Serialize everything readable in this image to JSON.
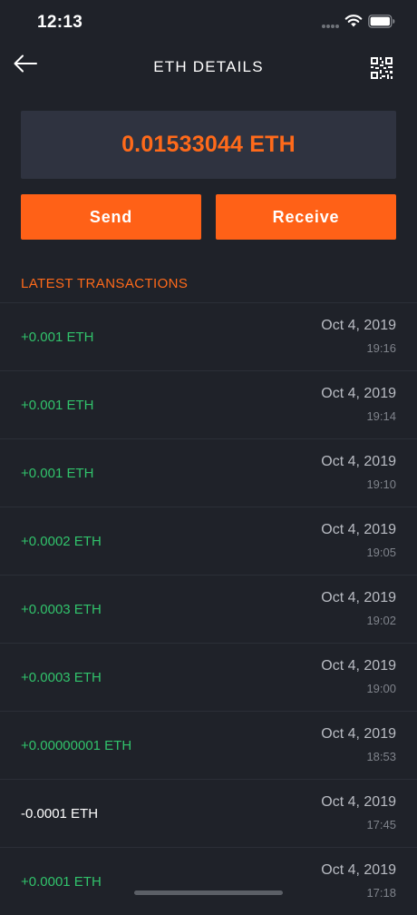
{
  "status_bar": {
    "time": "12:13"
  },
  "nav": {
    "title": "ETH DETAILS",
    "back_icon": "arrow-left-icon",
    "qr_icon": "qr-code-icon"
  },
  "balance": {
    "amount": "0.01533044 ETH"
  },
  "actions": {
    "send_label": "Send",
    "receive_label": "Receive"
  },
  "transactions": {
    "title": "LATEST TRANSACTIONS",
    "items": [
      {
        "amount": "+0.001 ETH",
        "direction": "in",
        "date": "Oct 4, 2019",
        "time": "19:16"
      },
      {
        "amount": "+0.001 ETH",
        "direction": "in",
        "date": "Oct 4, 2019",
        "time": "19:14"
      },
      {
        "amount": "+0.001 ETH",
        "direction": "in",
        "date": "Oct 4, 2019",
        "time": "19:10"
      },
      {
        "amount": "+0.0002 ETH",
        "direction": "in",
        "date": "Oct 4, 2019",
        "time": "19:05"
      },
      {
        "amount": "+0.0003 ETH",
        "direction": "in",
        "date": "Oct 4, 2019",
        "time": "19:02"
      },
      {
        "amount": "+0.0003 ETH",
        "direction": "in",
        "date": "Oct 4, 2019",
        "time": "19:00"
      },
      {
        "amount": "+0.00000001 ETH",
        "direction": "in",
        "date": "Oct 4, 2019",
        "time": "18:53"
      },
      {
        "amount": "-0.0001 ETH",
        "direction": "out",
        "date": "Oct 4, 2019",
        "time": "17:45"
      },
      {
        "amount": "+0.0001 ETH",
        "direction": "in",
        "date": "Oct 4, 2019",
        "time": "17:18"
      }
    ]
  },
  "colors": {
    "background": "#1f2229",
    "accent": "#ff6117",
    "positive": "#31c26b",
    "card": "#2f3340"
  }
}
